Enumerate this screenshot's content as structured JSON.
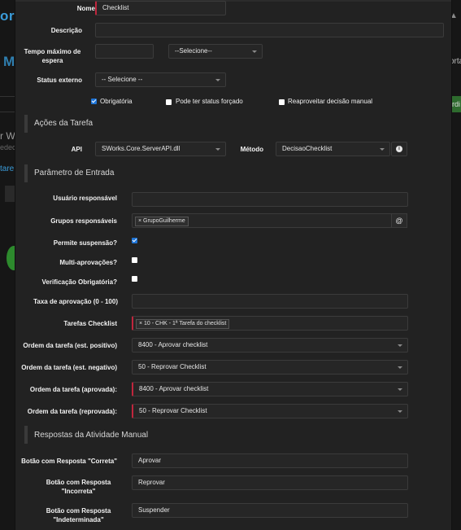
{
  "background": {
    "title_fragment": "orr",
    "m_fragment": "M",
    "wo_fragment": "r Wo",
    "wo_sub_fragment": "edec",
    "tare_fragment": "tare",
    "right_fragment_1": "ortal",
    "right_fragment_3": "ardi"
  },
  "form": {
    "nome": {
      "label": "Nome",
      "value": "Checklist"
    },
    "descricao": {
      "label": "Descrição",
      "value": ""
    },
    "tempo": {
      "label": "Tempo máximo de espera",
      "value": "",
      "unit_select": "--Selecione--"
    },
    "status_externo": {
      "label": "Status externo",
      "value": "-- Selecione --"
    },
    "checkboxes": [
      {
        "label": "Obrigatória",
        "checked": true
      },
      {
        "label": "Pode ter status forçado",
        "checked": false
      },
      {
        "label": "Reaproveitar decisão manual",
        "checked": false
      }
    ]
  },
  "acoes": {
    "title": "Ações da Tarefa",
    "api": {
      "label": "API",
      "value": "SWorks.Core.ServerAPI.dll"
    },
    "metodo": {
      "label": "Método",
      "value": "DecisaoChecklist"
    }
  },
  "parametro": {
    "title": "Parâmetro de Entrada",
    "usuario": {
      "label": "Usuário responsável",
      "value": ""
    },
    "grupos": {
      "label": "Grupos responsáveis",
      "tag": "× GrupoGuilherme",
      "addon": "@"
    },
    "suspensao": {
      "label": "Permite suspensão?",
      "checked": true
    },
    "multi": {
      "label": "Multi-aprovações?",
      "checked": false
    },
    "verificacao": {
      "label": "Verificação Obrigatória?",
      "checked": false
    },
    "taxa": {
      "label": "Taxa de aprovação (0 - 100)",
      "value": ""
    },
    "tarefas": {
      "label": "Tarefas Checklist",
      "tag": "× 10 - CHK - 1ª Tarefa do checklist"
    },
    "ordem_pos": {
      "label": "Ordem da tarefa (est. positivo)",
      "value": "8400 - Aprovar checklist"
    },
    "ordem_neg": {
      "label": "Ordem da tarefa (est. negativo)",
      "value": "50 - Reprovar Checklist"
    },
    "ordem_apr": {
      "label": "Ordem da tarefa (aprovada):",
      "value": "8400 - Aprovar checklist"
    },
    "ordem_rep": {
      "label": "Ordem da tarefa (reprovada):",
      "value": "50 - Reprovar Checklist"
    }
  },
  "respostas": {
    "title": "Respostas da Atividade Manual",
    "correta": {
      "label": "Botão com Resposta \"Correta\"",
      "value": "Aprovar"
    },
    "incorreta": {
      "label": "Botão com Resposta \"Incorreta\"",
      "value": "Reprovar"
    },
    "indeterminada": {
      "label": "Botão com Resposta \"Indeterminada\"",
      "value": "Suspender"
    }
  },
  "colors": {
    "accent": "#1e74d6",
    "required": "#c0263d",
    "modal_bg": "#222222"
  }
}
